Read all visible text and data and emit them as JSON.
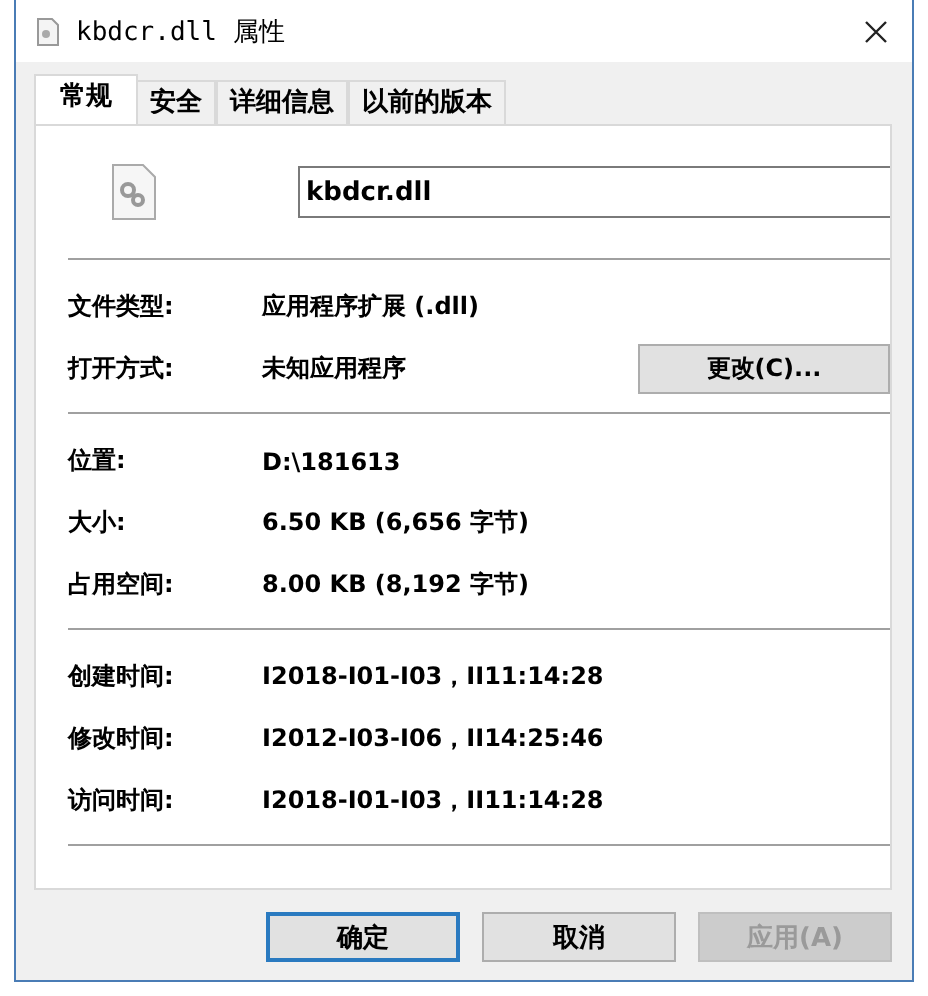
{
  "window": {
    "title": "kbdcr.dll 属性"
  },
  "tabs": [
    {
      "label": "常规",
      "selected": true
    },
    {
      "label": "安全",
      "selected": false
    },
    {
      "label": "详细信息",
      "selected": false
    },
    {
      "label": "以前的版本",
      "selected": false
    }
  ],
  "file_name": "kbdcr.dll",
  "sections": [
    [
      {
        "label": "文件类型:",
        "value": "应用程序扩展 (.dll)"
      },
      {
        "label": "打开方式:",
        "value": "未知应用程序",
        "button": "更改(C)..."
      }
    ],
    [
      {
        "label": "位置:",
        "value": "D:\\181613"
      },
      {
        "label": "大小:",
        "value": "6.50 KB (6,656 字节)"
      },
      {
        "label": "占用空间:",
        "value": "8.00 KB (8,192 字节)"
      }
    ],
    [
      {
        "label": "创建时间:",
        "value": "I2018-I01-I03，II11:14:28"
      },
      {
        "label": "修改时间:",
        "value": "I2012-I03-I06，II14:25:46"
      },
      {
        "label": "访问时间:",
        "value": "I2018-I01-I03，II11:14:28"
      }
    ]
  ],
  "buttons": [
    {
      "label": "确定",
      "default": true,
      "disabled": false
    },
    {
      "label": "取消",
      "default": false,
      "disabled": false
    },
    {
      "label": "应用(A)",
      "default": false,
      "disabled": true
    }
  ]
}
